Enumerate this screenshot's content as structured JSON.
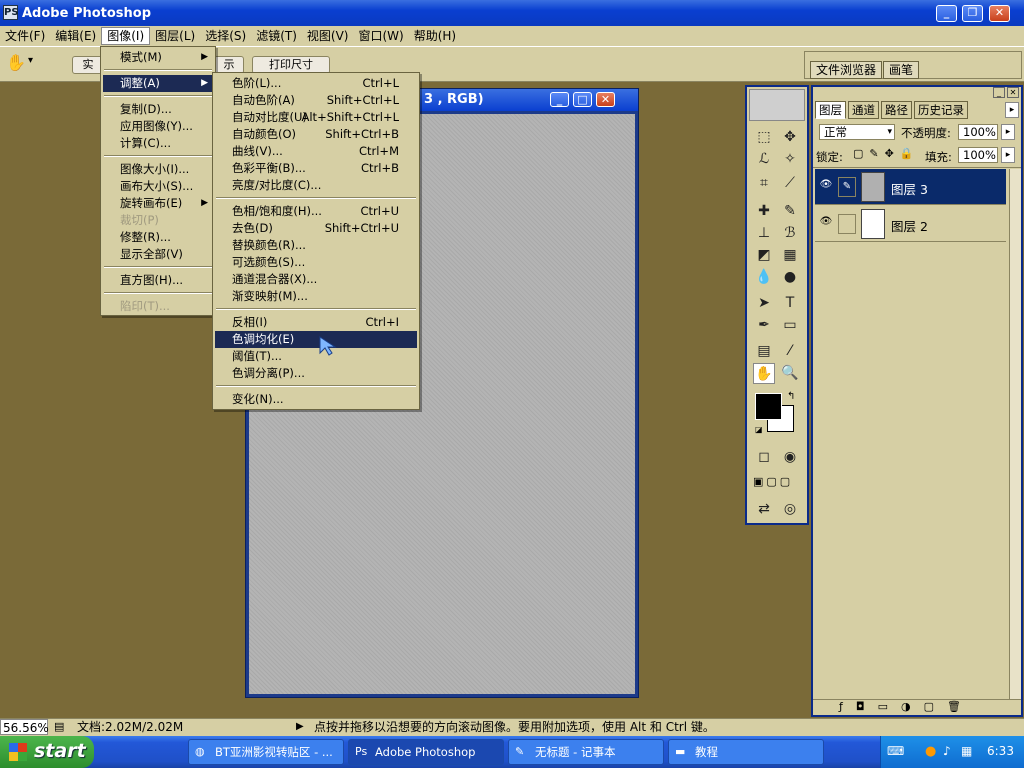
{
  "app": {
    "title": "Adobe Photoshop",
    "logo": "PS"
  },
  "menubar": [
    "文件(F)",
    "编辑(E)",
    "图像(I)",
    "图层(L)",
    "选择(S)",
    "滤镜(T)",
    "视图(V)",
    "窗口(W)",
    "帮助(H)"
  ],
  "options": {
    "btn_partial_1": "实",
    "btn_partial_2": "示",
    "print_size": "打印尺寸"
  },
  "palette_well": {
    "tab1": "文件浏览器",
    "tab2": "画笔"
  },
  "document": {
    "title": "3 , RGB)"
  },
  "image_menu": [
    {
      "label": "模式(M)",
      "submenu": true
    },
    {
      "label": "调整(A)",
      "submenu": true,
      "highlight": true
    },
    {
      "label": "复制(D)..."
    },
    {
      "label": "应用图像(Y)..."
    },
    {
      "label": "计算(C)..."
    },
    {
      "label": "图像大小(I)..."
    },
    {
      "label": "画布大小(S)..."
    },
    {
      "label": "旋转画布(E)",
      "submenu": true
    },
    {
      "label": "裁切(P)",
      "disabled": true
    },
    {
      "label": "修整(R)..."
    },
    {
      "label": "显示全部(V)"
    },
    {
      "label": "直方图(H)..."
    },
    {
      "label": "陷印(T)...",
      "disabled": true
    }
  ],
  "adjust_menu": [
    {
      "label": "色阶(L)...",
      "shortcut": "Ctrl+L"
    },
    {
      "label": "自动色阶(A)",
      "shortcut": "Shift+Ctrl+L"
    },
    {
      "label": "自动对比度(U)",
      "shortcut": "Alt+Shift+Ctrl+L"
    },
    {
      "label": "自动颜色(O)",
      "shortcut": "Shift+Ctrl+B"
    },
    {
      "label": "曲线(V)...",
      "shortcut": "Ctrl+M"
    },
    {
      "label": "色彩平衡(B)...",
      "shortcut": "Ctrl+B"
    },
    {
      "label": "亮度/对比度(C)...",
      "shortcut": ""
    },
    {
      "label": "色相/饱和度(H)...",
      "shortcut": "Ctrl+U"
    },
    {
      "label": "去色(D)",
      "shortcut": "Shift+Ctrl+U"
    },
    {
      "label": "替换颜色(R)...",
      "shortcut": ""
    },
    {
      "label": "可选颜色(S)...",
      "shortcut": ""
    },
    {
      "label": "通道混合器(X)...",
      "shortcut": ""
    },
    {
      "label": "渐变映射(M)...",
      "shortcut": ""
    },
    {
      "label": "反相(I)",
      "shortcut": "Ctrl+I"
    },
    {
      "label": "色调均化(E)",
      "shortcut": "",
      "highlight": true
    },
    {
      "label": "阈值(T)...",
      "shortcut": ""
    },
    {
      "label": "色调分离(P)...",
      "shortcut": ""
    },
    {
      "label": "变化(N)...",
      "shortcut": ""
    }
  ],
  "layers": {
    "tabs": [
      "图层",
      "通道",
      "路径",
      "历史记录"
    ],
    "blend_mode": "正常",
    "opacity_label": "不透明度:",
    "opacity": "100%",
    "lock_label": "锁定:",
    "fill_label": "填充:",
    "fill": "100%",
    "rows": [
      {
        "name": "图层 3",
        "selected": true
      },
      {
        "name": "图层 2",
        "selected": false
      }
    ]
  },
  "status": {
    "zoom": "56.56%",
    "doc": "文档:2.02M/2.02M",
    "hint": "点按并拖移以沿想要的方向滚动图像。要用附加选项，使用 Alt 和 Ctrl 键。"
  },
  "taskbar": {
    "start": "start",
    "tasks": [
      "BT亚洲影视转贴区 - ...",
      "Adobe Photoshop",
      "无标题 - 记事本",
      "教程"
    ],
    "clock": "6:33"
  },
  "colors": {
    "title_blue": "#0a3fd0",
    "chrome": "#d6cfa4",
    "workspace": "#7a6a38",
    "highlight": "#1c2a54"
  }
}
